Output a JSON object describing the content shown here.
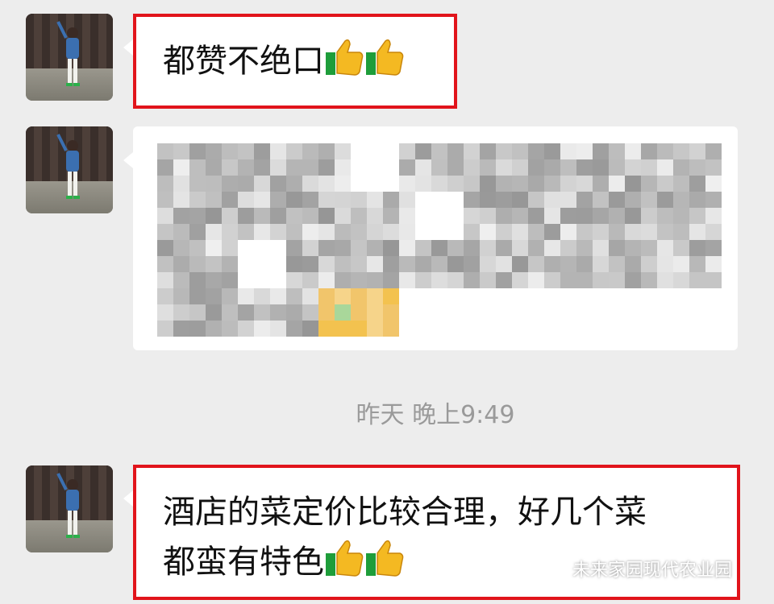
{
  "messages": [
    {
      "text": "都赞不绝口",
      "emoji": "thumbs-up x2"
    },
    {
      "text": "blurred message (pixelated)",
      "emoji": "thumbs-up x2"
    },
    {
      "text_line1": "酒店的菜定价比较合理，好几个菜",
      "text_line2": "都蛮有特色",
      "emoji": "thumbs-up x2"
    }
  ],
  "timestamp": "昨天 晚上9:49",
  "watermark": "未来家园现代农业园",
  "colors": {
    "background": "#ededed",
    "bubble": "#ffffff",
    "highlight": "#e1141b",
    "timestamp": "#9a9a9a"
  }
}
